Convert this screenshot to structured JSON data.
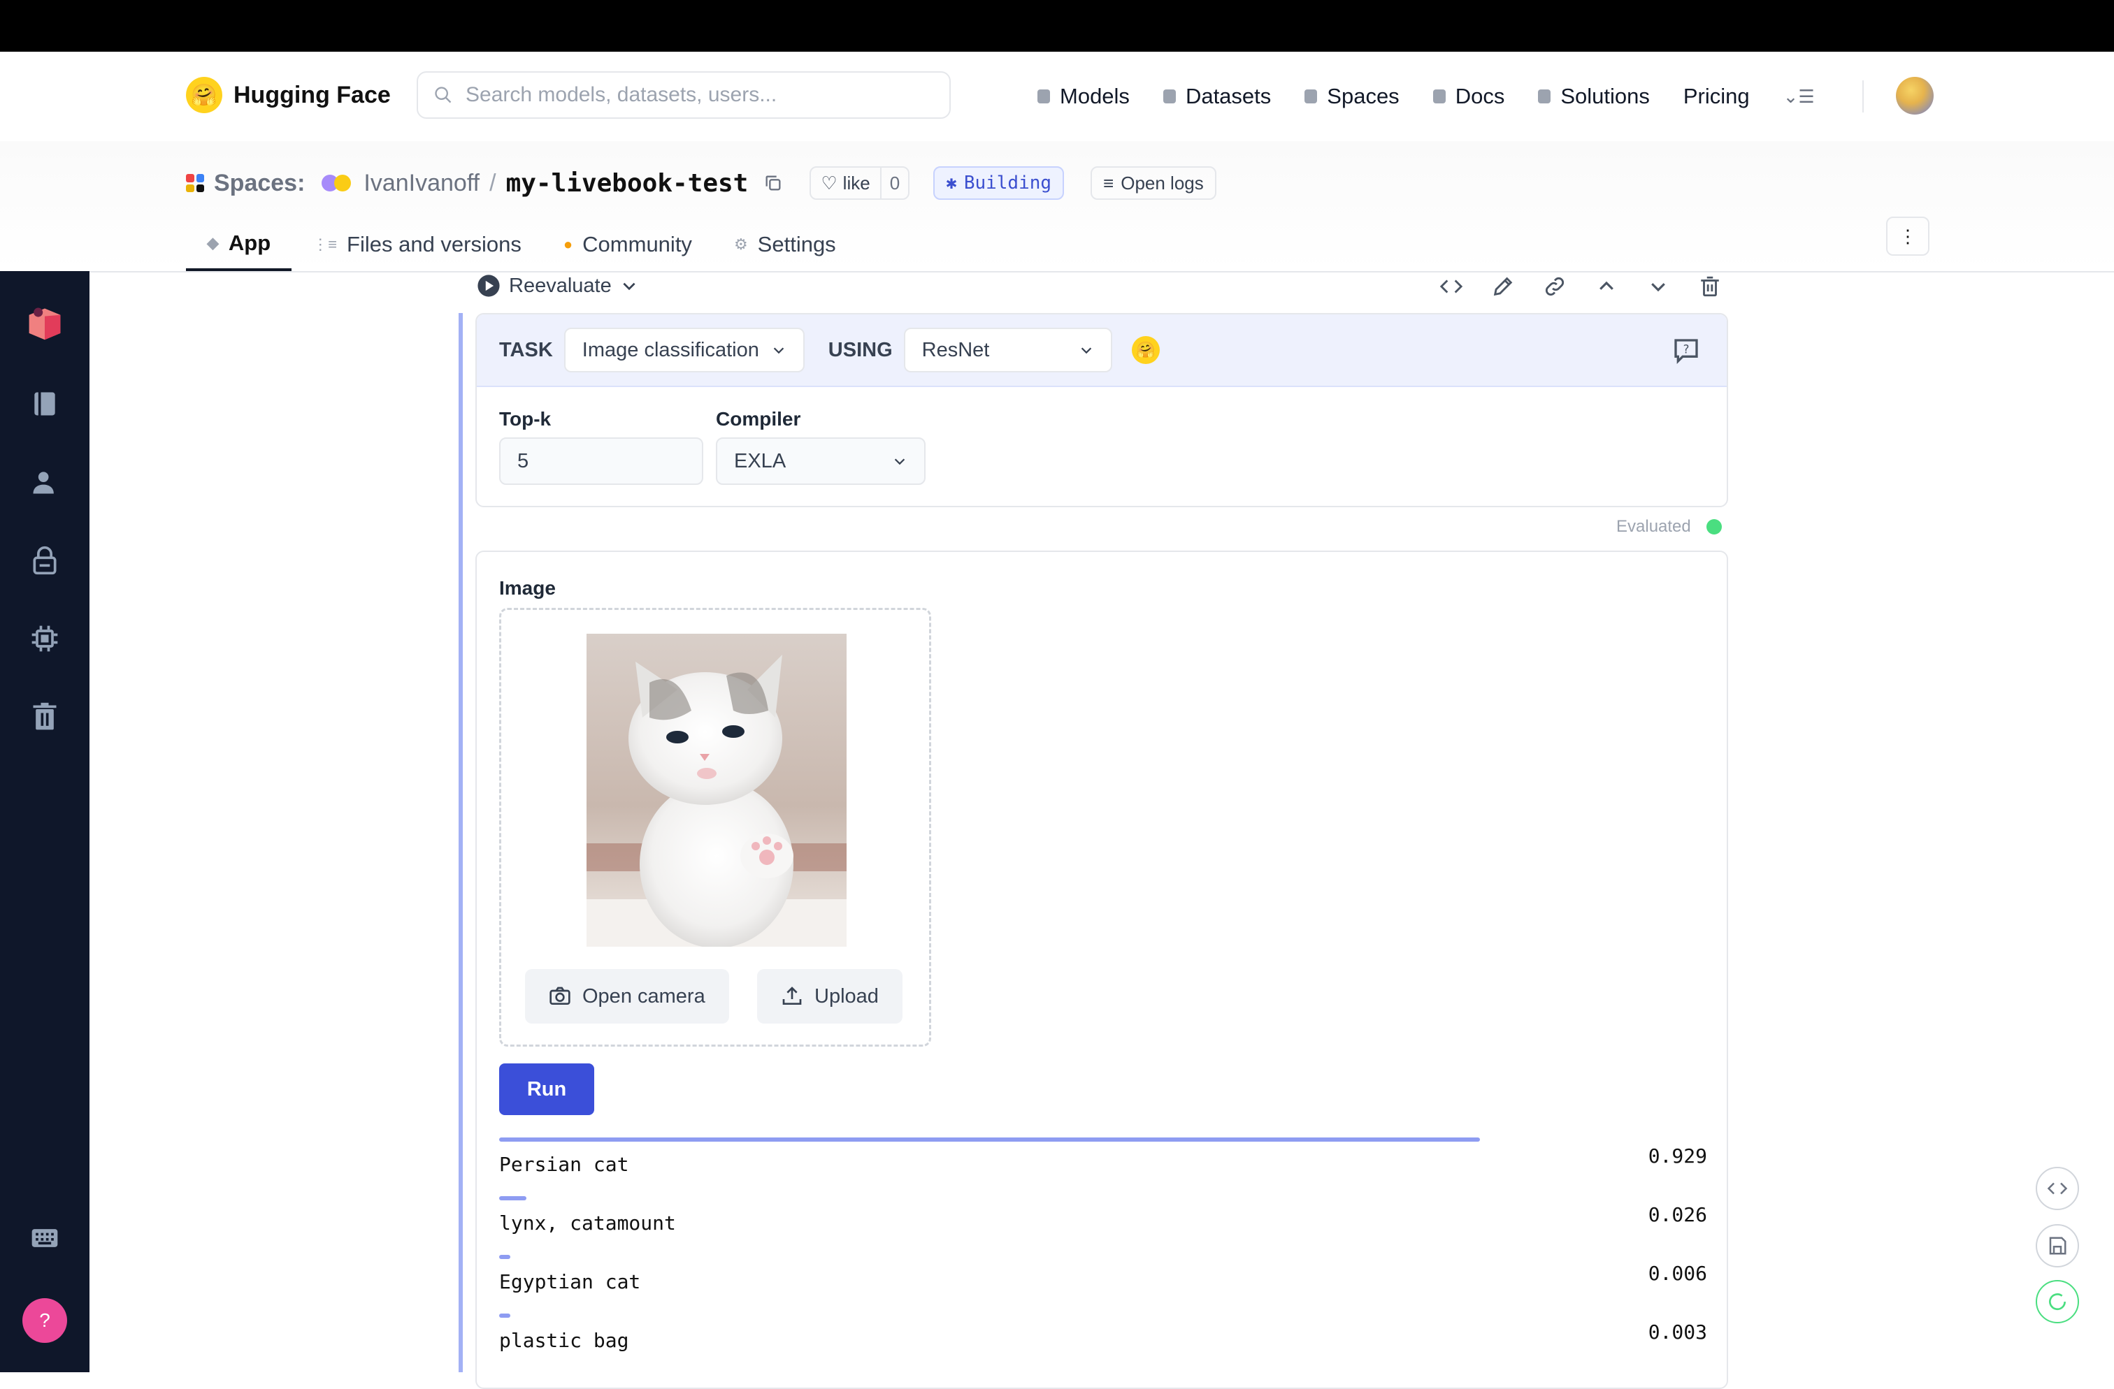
{
  "header": {
    "brand": "Hugging Face",
    "search_placeholder": "Search models, datasets, users...",
    "nav": [
      "Models",
      "Datasets",
      "Spaces",
      "Docs",
      "Solutions",
      "Pricing"
    ]
  },
  "space": {
    "label": "Spaces:",
    "owner": "IvanIvanoff",
    "separator": "/",
    "repo": "my-livebook-test",
    "like_label": "like",
    "like_count": "0",
    "status": "Building",
    "logs_label": "Open logs",
    "tabs": [
      "App",
      "Files and versions",
      "Community",
      "Settings"
    ]
  },
  "cell": {
    "reevaluate": "Reevaluate",
    "task_label": "TASK",
    "task_value": "Image classification",
    "using_label": "USING",
    "model_value": "ResNet",
    "topk_label": "Top-k",
    "topk_value": "5",
    "compiler_label": "Compiler",
    "compiler_value": "EXLA",
    "status": "Evaluated"
  },
  "output": {
    "image_label": "Image",
    "open_camera": "Open camera",
    "upload": "Upload",
    "run": "Run",
    "predictions": [
      {
        "label": "Persian cat",
        "value": "0.929",
        "score": 0.929
      },
      {
        "label": "lynx, catamount",
        "value": "0.026",
        "score": 0.026
      },
      {
        "label": "Egyptian cat",
        "value": "0.006",
        "score": 0.006
      },
      {
        "label": "plastic bag",
        "value": "0.003",
        "score": 0.003
      }
    ]
  },
  "colors": {
    "accent": "#3b4fd9",
    "bar": "#8e9cf2",
    "sidebar": "#0f172a",
    "evaluated": "#4ade80"
  }
}
